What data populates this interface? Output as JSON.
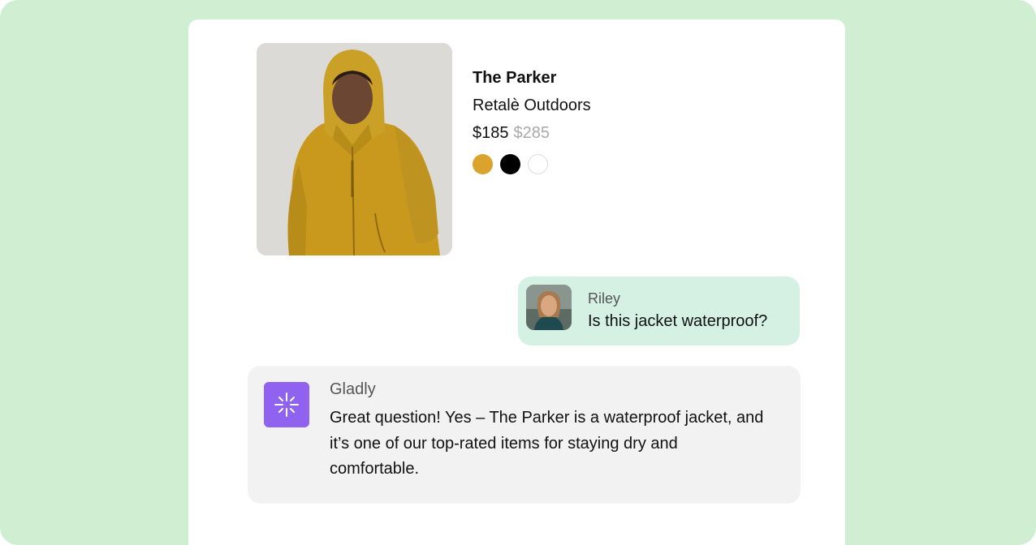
{
  "product": {
    "title": "The Parker",
    "brand": "Retalè Outdoors",
    "price": "$185",
    "original_price": "$285",
    "image_icon": "jacket-photo",
    "swatches": [
      {
        "name": "mustard",
        "color": "#dba22c"
      },
      {
        "name": "black",
        "color": "#000000"
      },
      {
        "name": "white",
        "color": "#ffffff"
      }
    ]
  },
  "messages": {
    "customer": {
      "name": "Riley",
      "text": "Is this jacket waterproof?",
      "avatar_icon": "user-photo"
    },
    "agent": {
      "name": "Gladly",
      "text": "Great question! Yes – The Parker is a waterproof jacket, and it’s one of our top-rated items for staying dry and comfortable.",
      "avatar_icon": "sparkle-icon",
      "avatar_color": "#8f63ef"
    }
  },
  "colors": {
    "background": "#cfeed2",
    "panel": "#ffffff",
    "customer_bubble": "#d4f1e4",
    "agent_bubble": "#f2f2f2",
    "muted_price": "#a9a9a9"
  }
}
